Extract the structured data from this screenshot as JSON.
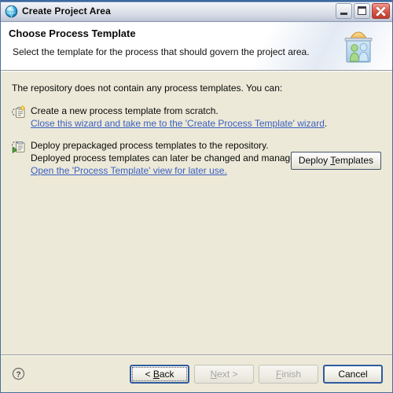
{
  "window": {
    "title": "Create Project Area",
    "icon": "globe-icon",
    "controls": {
      "minimize": "Minimize",
      "maximize": "Maximize",
      "close": "Close"
    }
  },
  "banner": {
    "title": "Choose Process Template",
    "subtitle": "Select the template for the process that should govern the project area.",
    "icon": "project-area-icon"
  },
  "content": {
    "intro": "The repository does not contain any process templates. You can:",
    "options": [
      {
        "icon": "new-process-template-icon",
        "line1": "Create a new process template from scratch.",
        "link": "Close this wizard and take me to the 'Create Process Template' wizard",
        "link_trailing": "."
      },
      {
        "icon": "deploy-process-template-icon",
        "line1": "Deploy prepackaged process templates to the repository.",
        "line2": "Deployed process templates can later be changed and managed.",
        "link": "Open the 'Process Template' view for later use.",
        "link_trailing": ""
      }
    ],
    "deploy_button": {
      "prefix": "Deploy ",
      "mnemonic": "T",
      "suffix": "emplates"
    }
  },
  "footer": {
    "help": "help-icon",
    "buttons": [
      {
        "prefix": "< ",
        "mnemonic": "B",
        "suffix": "ack",
        "state": "focused"
      },
      {
        "prefix": "",
        "mnemonic": "N",
        "suffix": "ext >",
        "state": "disabled"
      },
      {
        "prefix": "",
        "mnemonic": "F",
        "suffix": "inish",
        "state": "disabled"
      },
      {
        "prefix": "",
        "mnemonic": "C",
        "suffix": "ancel",
        "state": "default"
      }
    ]
  },
  "colors": {
    "link": "#3b5fc0",
    "dialog_bg": "#ece9d8",
    "title_accent": "#2b5a9b",
    "close_red": "#c0392b",
    "default_button_border": "#2f5b9e"
  }
}
